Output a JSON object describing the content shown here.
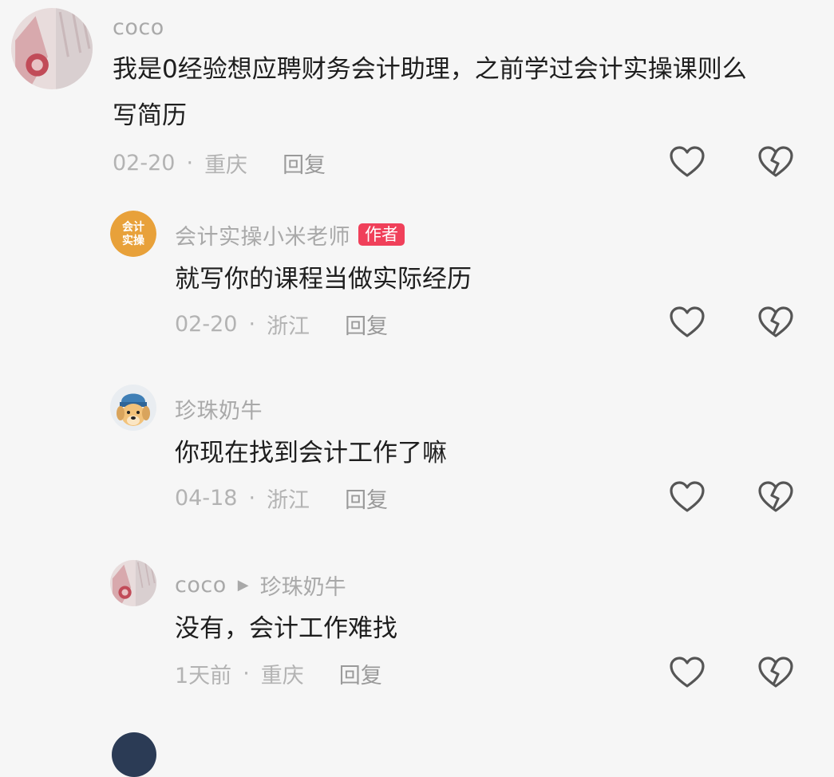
{
  "comments": [
    {
      "username": "coco",
      "text_lines": [
        "我是0经验想应聘财务会计助理，之前学过会计实操课则么",
        "写简历"
      ],
      "date": "02-20",
      "location": "重庆",
      "reply_label": "回复"
    },
    {
      "username": "会计实操小米老师",
      "author_tag": "作者",
      "avatar_text": [
        "会计",
        "实操"
      ],
      "text": "就写你的课程当做实际经历",
      "date": "02-20",
      "location": "浙江",
      "reply_label": "回复"
    },
    {
      "username": "珍珠奶牛",
      "text": "你现在找到会计工作了嘛",
      "date": "04-18",
      "location": "浙江",
      "reply_label": "回复"
    },
    {
      "username": "coco",
      "reply_to": "珍珠奶牛",
      "text": "没有，会计工作难找",
      "date": "1天前",
      "location": "重庆",
      "reply_label": "回复"
    }
  ],
  "separator": "·",
  "icons": {
    "like": "heart-outline-icon",
    "dislike": "broken-heart-icon",
    "reply_arrow": "triangle-right-icon"
  },
  "colors": {
    "author_tag": "#f0405a",
    "username": "#a9a9a9",
    "text": "#1e1e1e"
  }
}
